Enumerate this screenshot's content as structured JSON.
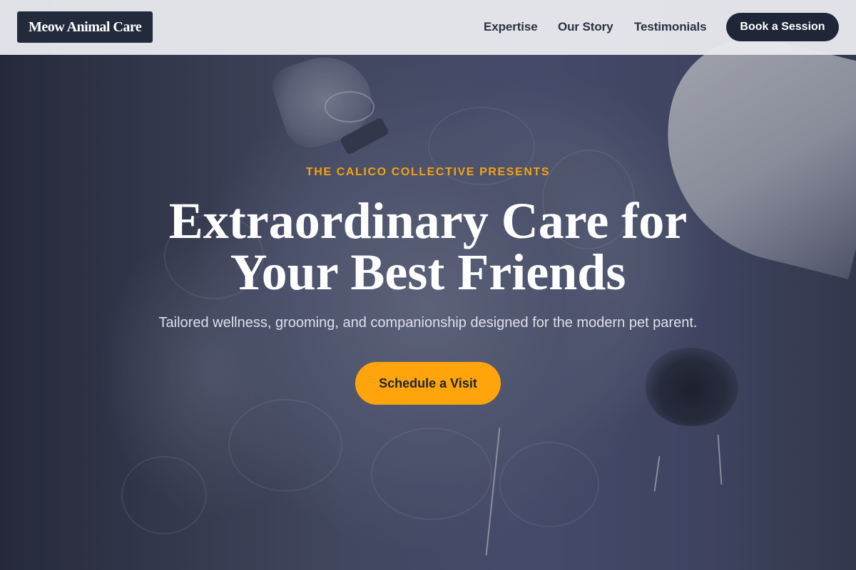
{
  "header": {
    "logo": "Meow Animal Care",
    "nav": [
      "Expertise",
      "Our Story",
      "Testimonials"
    ],
    "cta": "Book a Session"
  },
  "hero": {
    "eyebrow": "THE CALICO COLLECTIVE PRESENTS",
    "headline_line1": "Extraordinary Care for",
    "headline_line2": "Your Best Friends",
    "subtitle": "Tailored wellness, grooming, and companionship designed for the modern pet parent.",
    "cta": "Schedule a Visit"
  },
  "colors": {
    "accent": "#ffa40a",
    "eyebrow": "#f5a30f",
    "navy": "#1f2638",
    "header_bg": "#e8e9ed"
  }
}
